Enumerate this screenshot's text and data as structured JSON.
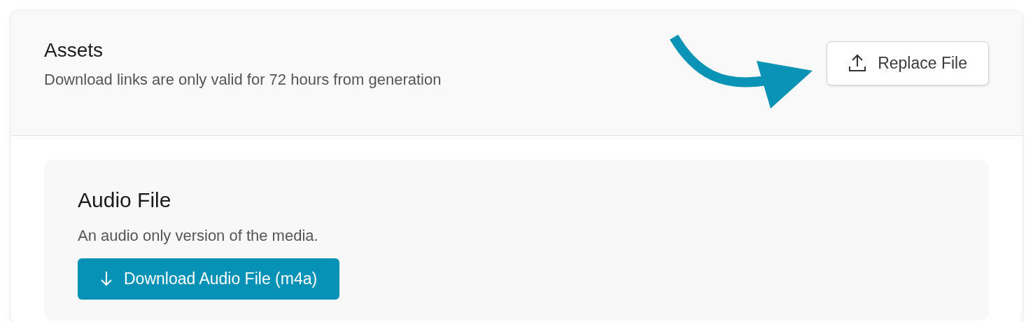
{
  "header": {
    "title": "Assets",
    "subtitle": "Download links are only valid for 72 hours from generation",
    "action": {
      "label": "Replace File"
    }
  },
  "assets": [
    {
      "title": "Audio File",
      "description": "An audio only version of the media.",
      "button": {
        "label": "Download Audio File (m4a)"
      }
    }
  ]
}
